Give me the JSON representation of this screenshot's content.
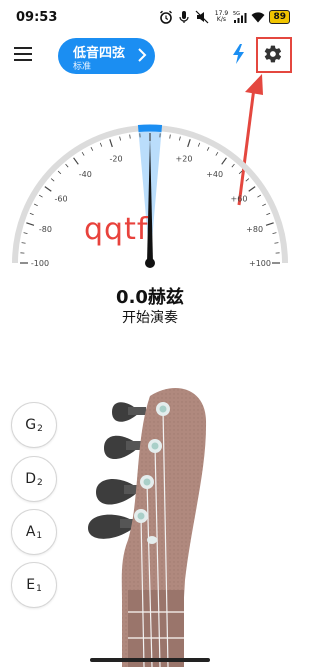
{
  "status_bar": {
    "time": "09:53",
    "net_speed_value": "17.9",
    "net_speed_unit": "K/s",
    "network_type": "5G",
    "battery": "89"
  },
  "header": {
    "tuning_title": "低音四弦",
    "tuning_subtitle": "标准",
    "icons": [
      "menu-icon",
      "flash-icon",
      "gear-icon"
    ]
  },
  "gauge": {
    "tick_labels_left": [
      "-20",
      "-40",
      "-60",
      "-80",
      "-100"
    ],
    "tick_labels_right": [
      "+20",
      "+40",
      "+60",
      "+80",
      "+100"
    ],
    "needle_value": 0,
    "accent_color": "#1b8ef2",
    "needle_color": "#111111"
  },
  "watermark": "qqtf",
  "reading": {
    "frequency": "0.0赫兹",
    "status": "开始演奏"
  },
  "strings": [
    {
      "note": "G",
      "octave": "2"
    },
    {
      "note": "D",
      "octave": "2"
    },
    {
      "note": "A",
      "octave": "1"
    },
    {
      "note": "E",
      "octave": "1"
    }
  ],
  "colors": {
    "annotation_red": "#e4473f",
    "headstock_brown": "#b0897e",
    "peg_dark": "#3d3d3d"
  }
}
